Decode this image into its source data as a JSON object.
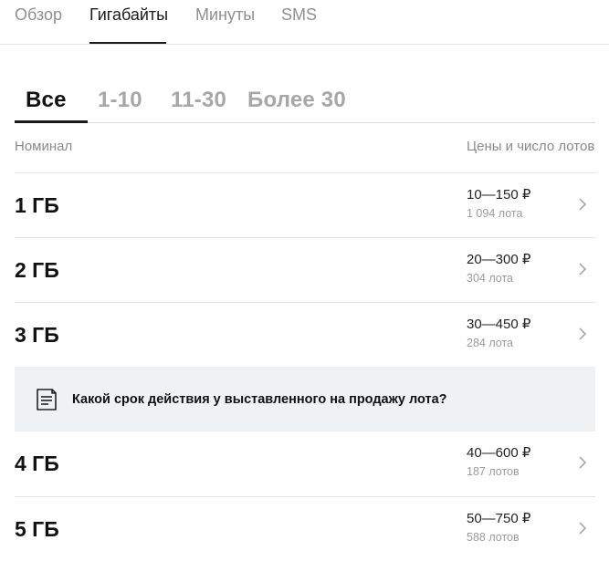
{
  "top_tabs": [
    {
      "label": "Обзор"
    },
    {
      "label": "Гигабайты"
    },
    {
      "label": "Минуты"
    },
    {
      "label": "SMS"
    }
  ],
  "active_top_tab": "Гигабайты",
  "filters": [
    {
      "label": "Все"
    },
    {
      "label": "1-10"
    },
    {
      "label": "11-30"
    },
    {
      "label": "Более 30"
    }
  ],
  "active_filter": "Все",
  "columns": {
    "left": "Номинал",
    "right": "Цены и число лотов"
  },
  "rows": [
    {
      "title": "1 ГБ",
      "price": "10—150 ₽",
      "lots": "1 094 лота"
    },
    {
      "title": "2 ГБ",
      "price": "20—300 ₽",
      "lots": "304 лота"
    },
    {
      "title": "3 ГБ",
      "price": "30—450 ₽",
      "lots": "284 лота"
    },
    {
      "title": "4 ГБ",
      "price": "40—600 ₽",
      "lots": "187 лотов"
    },
    {
      "title": "5 ГБ",
      "price": "50—750 ₽",
      "lots": "588 лотов"
    }
  ],
  "banner": {
    "text": "Какой срок действия у выставленного на продажу лота?",
    "icon": "document-icon"
  },
  "icons": {
    "row_chevron": "chevron-right-icon"
  },
  "colors": {
    "text": "#111111",
    "muted": "#9b9b9b",
    "banner_bg": "#f0f1f3",
    "divider": "#e4e4e4"
  }
}
